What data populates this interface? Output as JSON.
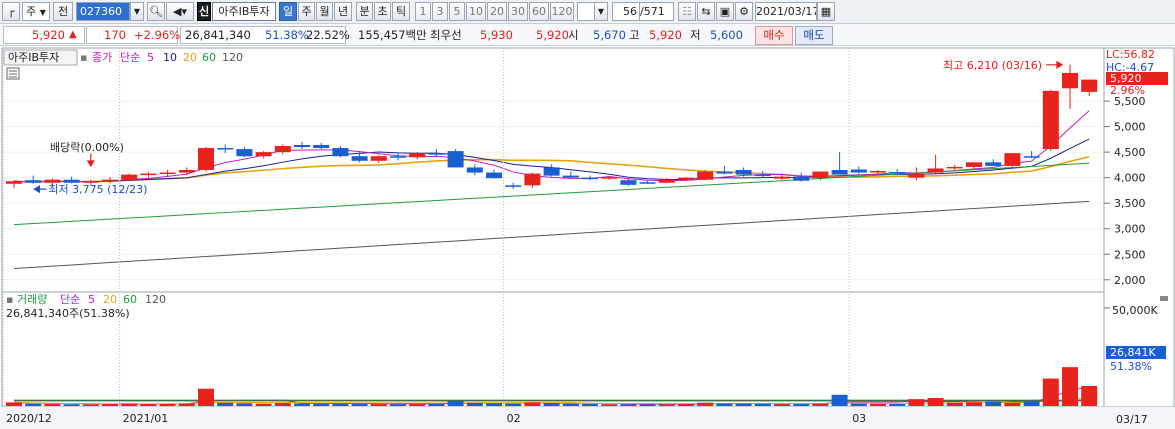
{
  "toolbar": {
    "market_type": "주",
    "scope": "전",
    "stock_code": "027360",
    "stock_name": "아주IB투자",
    "credit_badge": "신",
    "periods": [
      "일",
      "주",
      "월",
      "년",
      "분",
      "초",
      "틱"
    ],
    "selected_period": "일",
    "intervals": [
      "1",
      "3",
      "5",
      "10",
      "20",
      "30",
      "60",
      "120"
    ],
    "page_counter": "56",
    "page_total": "/571",
    "date": "2021/03/17"
  },
  "infobar": {
    "price": "5,920",
    "change": "170",
    "change_pct": "+2.96%",
    "volume": "26,841,340",
    "volume_ratio": "51.38%",
    "turnover": "22.52%",
    "amount": "155,457백만",
    "best_bid_label": "최우선",
    "ask": "5,930",
    "bid": "5,920",
    "open_label": "시",
    "open": "5,670",
    "high_label": "고",
    "high": "5,920",
    "low_label": "저",
    "low": "5,600",
    "buy_button": "매수",
    "sell_button": "매도"
  },
  "colors": {
    "up": "#e6231d",
    "down": "#1a5fd1",
    "ma5": "#c020c0",
    "ma10": "#1a1f8a",
    "ma20": "#e3a412",
    "ma60": "#209a3c",
    "ma120": "#555555"
  },
  "chart_data": [
    {
      "type": "candlestick",
      "title": "아주IB투자",
      "legend_prefix": "종가",
      "legend_method": "단순",
      "ma_periods": [
        "5",
        "10",
        "20",
        "60",
        "120"
      ],
      "ylim": [
        1800,
        6500
      ],
      "y_ticks": [
        2000,
        2500,
        3000,
        3500,
        4000,
        4500,
        5000,
        5500
      ],
      "y_tick_labels": [
        "2,000",
        "2,500",
        "3,000",
        "3,500",
        "4,000",
        "4,500",
        "5,000",
        "5,500"
      ],
      "ohlc": [
        [
          3880,
          3950,
          3800,
          3930
        ],
        [
          3950,
          4040,
          3880,
          3900
        ],
        [
          3900,
          3980,
          3850,
          3960
        ],
        [
          3960,
          4020,
          3890,
          3900
        ],
        [
          3900,
          3960,
          3860,
          3930
        ],
        [
          3930,
          4010,
          3890,
          3960
        ],
        [
          3960,
          4080,
          3930,
          4060
        ],
        [
          4060,
          4120,
          4000,
          4080
        ],
        [
          4080,
          4150,
          4030,
          4100
        ],
        [
          4100,
          4200,
          4050,
          4150
        ],
        [
          4150,
          4600,
          4120,
          4580
        ],
        [
          4580,
          4650,
          4480,
          4560
        ],
        [
          4560,
          4600,
          4400,
          4420
        ],
        [
          4420,
          4520,
          4380,
          4500
        ],
        [
          4500,
          4650,
          4460,
          4620
        ],
        [
          4640,
          4700,
          4560,
          4600
        ],
        [
          4640,
          4680,
          4560,
          4580
        ],
        [
          4580,
          4620,
          4400,
          4420
        ],
        [
          4420,
          4500,
          4300,
          4330
        ],
        [
          4330,
          4450,
          4290,
          4420
        ],
        [
          4420,
          4480,
          4340,
          4400
        ],
        [
          4400,
          4500,
          4360,
          4480
        ],
        [
          4480,
          4560,
          4420,
          4450
        ],
        [
          4520,
          4560,
          4200,
          4200
        ],
        [
          4200,
          4260,
          4050,
          4100
        ],
        [
          4100,
          4160,
          3980,
          3990
        ],
        [
          3850,
          3900,
          3780,
          3820
        ],
        [
          3850,
          4100,
          3800,
          4080
        ],
        [
          4200,
          4260,
          4020,
          4040
        ],
        [
          4040,
          4120,
          3990,
          4000
        ],
        [
          4000,
          4040,
          3950,
          3980
        ],
        [
          3980,
          4030,
          3960,
          4010
        ],
        [
          3950,
          3990,
          3840,
          3860
        ],
        [
          3910,
          3940,
          3880,
          3900
        ],
        [
          3900,
          3990,
          3890,
          3960
        ],
        [
          3960,
          4010,
          3940,
          4000
        ],
        [
          3960,
          4150,
          3950,
          4120
        ],
        [
          4120,
          4230,
          4060,
          4080
        ],
        [
          4150,
          4200,
          4020,
          4060
        ],
        [
          4060,
          4130,
          4000,
          4040
        ],
        [
          3980,
          4050,
          3960,
          4020
        ],
        [
          4020,
          4100,
          3920,
          3940
        ],
        [
          3990,
          4100,
          3950,
          4120
        ],
        [
          4150,
          4500,
          4100,
          4060
        ],
        [
          4160,
          4220,
          4080,
          4100
        ],
        [
          4110,
          4150,
          4060,
          4130
        ],
        [
          4110,
          4170,
          4080,
          4090
        ],
        [
          4000,
          4200,
          3950,
          4080
        ],
        [
          4100,
          4450,
          4080,
          4180
        ],
        [
          4190,
          4250,
          4130,
          4210
        ],
        [
          4210,
          4300,
          4180,
          4300
        ],
        [
          4300,
          4360,
          4240,
          4230
        ],
        [
          4230,
          4460,
          4210,
          4480
        ],
        [
          4420,
          4520,
          4380,
          4400
        ],
        [
          4560,
          5720,
          4520,
          5700
        ],
        [
          5750,
          6210,
          5350,
          6050
        ],
        [
          5680,
          5920,
          5600,
          5920
        ]
      ],
      "max_annotation": {
        "label": "최고 6,210 (03/16)",
        "index": 55,
        "value": 6210
      },
      "min_annotation": {
        "label": "최저 3,775 (12/23)",
        "index": 2,
        "value": 3775
      },
      "dividend_annotation": {
        "label": "배당락(0.00%)",
        "index": 4
      },
      "right_labels": {
        "lc": "LC:56.82",
        "hc": "HC:-4.67",
        "price": "5,920",
        "pct": "2.96%"
      }
    },
    {
      "type": "bar",
      "title": "거래량",
      "legend_method": "단순",
      "ma_periods": [
        "5",
        "20",
        "60",
        "120"
      ],
      "header_value": "26,841,340주(51.38%)",
      "ylim": [
        0,
        52000000
      ],
      "y_tick_labels": [
        "50,000K"
      ],
      "right_labels": {
        "value": "26,841K",
        "pct": "51.38%"
      },
      "volume_millions": [
        1.8,
        1.2,
        1.1,
        0.9,
        0.8,
        0.9,
        1.2,
        1.0,
        1.1,
        1.3,
        8.8,
        1.6,
        1.4,
        1.2,
        1.5,
        1.3,
        1.2,
        1.2,
        1.1,
        1.0,
        0.9,
        1.0,
        1.1,
        2.6,
        1.6,
        1.3,
        1.2,
        1.8,
        1.5,
        1.1,
        1.0,
        0.9,
        0.9,
        0.8,
        0.8,
        1.0,
        1.7,
        1.3,
        1.2,
        1.1,
        1.0,
        1.0,
        1.2,
        5.7,
        1.2,
        1.1,
        1.0,
        3.5,
        4.1,
        1.7,
        1.9,
        2.2,
        1.6,
        2.4,
        14.0,
        19.8,
        10.2
      ]
    }
  ],
  "x_axis": {
    "labels": [
      {
        "text": "2020/12",
        "index": 0
      },
      {
        "text": "2021/01",
        "index": 6
      },
      {
        "text": "02",
        "index": 26
      },
      {
        "text": "03",
        "index": 44
      }
    ],
    "right_label": "03/17"
  }
}
